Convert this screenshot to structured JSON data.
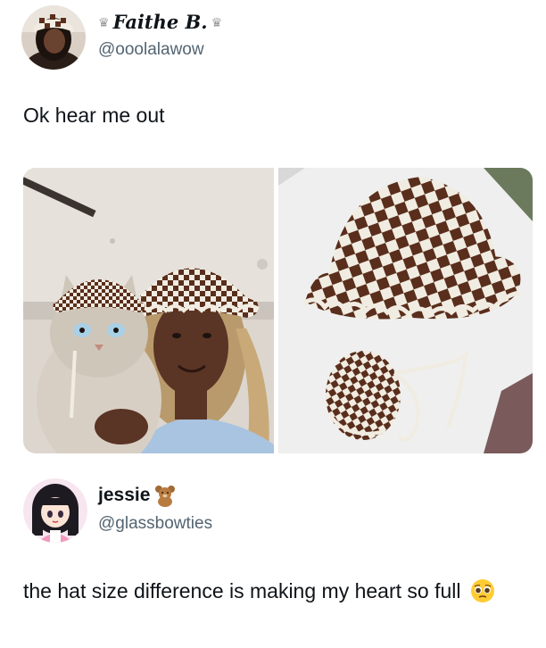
{
  "post1": {
    "display_name": "Faithe B.",
    "crown_left": "♛",
    "crown_right": "♛",
    "handle": "@ooolalawow",
    "text": "Ok hear me out",
    "avatar": "profile-photo",
    "images": [
      "woman-and-cat-in-checkered-hats-photo",
      "two-crochet-hats-photo"
    ]
  },
  "post2": {
    "display_name": "jessie",
    "handle": "@glassbowties",
    "name_badge_icon": "teddy-bear-icon",
    "text": "the hat size difference is making my heart so full",
    "text_emoji_icon": "pleading-face-emoji-icon",
    "avatar": "anime-girl-avatar"
  },
  "colors": {
    "hat_brown": "#5a2e1c",
    "hat_cream": "#f1ece1",
    "handle_gray": "#536471",
    "text_dark": "#0f1419"
  }
}
